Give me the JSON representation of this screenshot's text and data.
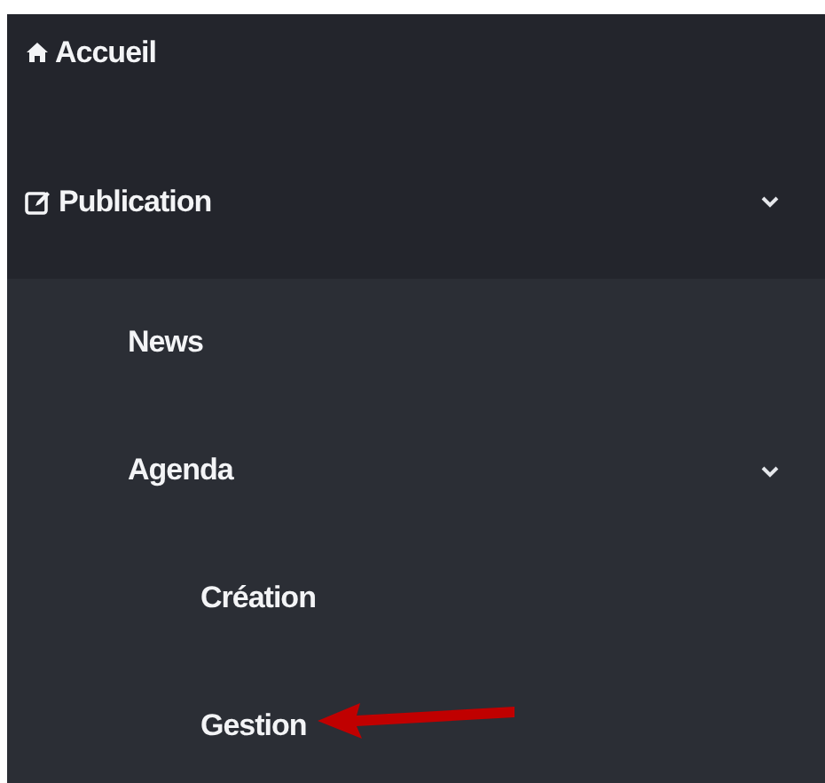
{
  "menu": [
    {
      "label": "Accueil",
      "kind": "home"
    },
    {
      "label": "Publication",
      "kind": "edit",
      "expanded": true,
      "children": [
        {
          "label": "News"
        },
        {
          "label": "Agenda",
          "expanded": true,
          "children": [
            {
              "label": "Création"
            },
            {
              "label": "Gestion",
              "pointed": true
            }
          ]
        }
      ]
    }
  ]
}
